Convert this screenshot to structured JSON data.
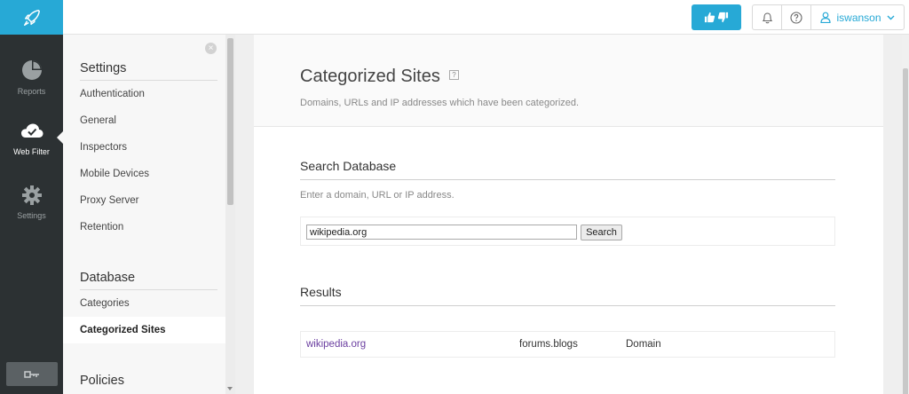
{
  "rail": {
    "items": [
      {
        "label": "Reports",
        "icon": "pie-chart-icon"
      },
      {
        "label": "Web Filter",
        "icon": "cloud-check-icon"
      },
      {
        "label": "Settings",
        "icon": "gear-icon"
      }
    ]
  },
  "topbar": {
    "username": "iswanson"
  },
  "sidebar": {
    "settings_heading": "Settings",
    "settings_items": [
      "Authentication",
      "General",
      "Inspectors",
      "Mobile Devices",
      "Proxy Server",
      "Retention"
    ],
    "database_heading": "Database",
    "database_items": [
      "Categories",
      "Categorized Sites"
    ],
    "policies_heading": "Policies"
  },
  "main": {
    "title": "Categorized Sites",
    "subtitle": "Domains, URLs and IP addresses which have been categorized.",
    "search_heading": "Search Database",
    "search_hint": "Enter a domain, URL or IP address.",
    "search_value": "wikipedia.org",
    "search_button": "Search",
    "results_heading": "Results",
    "results": [
      {
        "domain": "wikipedia.org",
        "category": "forums.blogs",
        "type": "Domain"
      }
    ]
  },
  "colors": {
    "accent": "#27a9d6",
    "rail": "#2c3133",
    "link": "#6b3fa0"
  }
}
